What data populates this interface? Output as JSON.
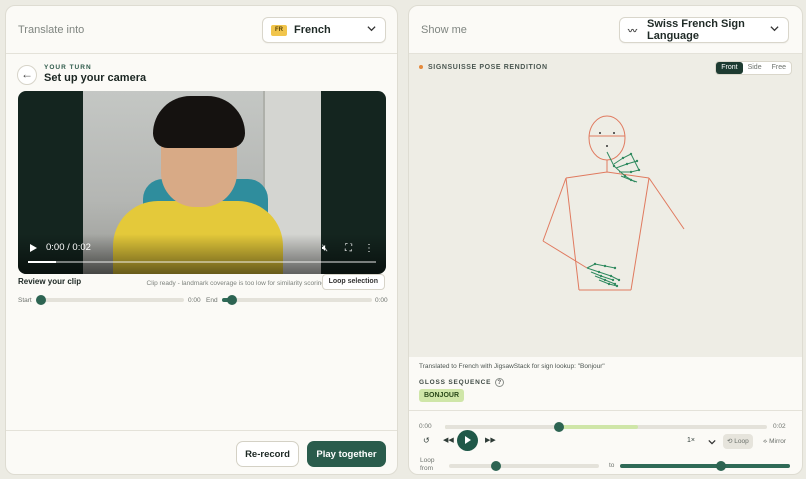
{
  "left": {
    "header_label": "Translate into",
    "language": {
      "flag": "FR",
      "name": "French"
    },
    "eyebrow": "YOUR TURN",
    "title": "Set up your camera",
    "video": {
      "time": "0:00 / 0:02"
    },
    "review_label": "Review your clip",
    "clip_status": "Clip ready - landmark coverage is too low for similarity scoring",
    "loop_selection": "Loop selection",
    "start_label": "Start",
    "start_value": "0:00",
    "end_label": "End",
    "end_value": "0:00",
    "rerecord": "Re-record",
    "play_together": "Play together"
  },
  "right": {
    "header_label": "Show me",
    "sign_language": "Swiss French Sign Language",
    "stage_label": "SIGNSUISSE POSE RENDITION",
    "views": [
      "Front",
      "Side",
      "Free"
    ],
    "active_view": "Front",
    "translated": "Translated to French with JigsawStack for sign lookup: \"Bonjour\"",
    "gloss_label": "GLOSS SEQUENCE",
    "gloss": [
      "BONJOUR"
    ],
    "player": {
      "time_start": "0:00",
      "time_end": "0:02",
      "progress": 0.41,
      "speed": "1×",
      "loop": "Loop",
      "mirror": "Mirror",
      "loop_from": "Loop from",
      "to": "to"
    }
  },
  "colors": {
    "accent": "#2a5c4c",
    "skeleton": "#e07a5f",
    "hand": "#2f8a5f",
    "chip": "#cfe6a8"
  }
}
